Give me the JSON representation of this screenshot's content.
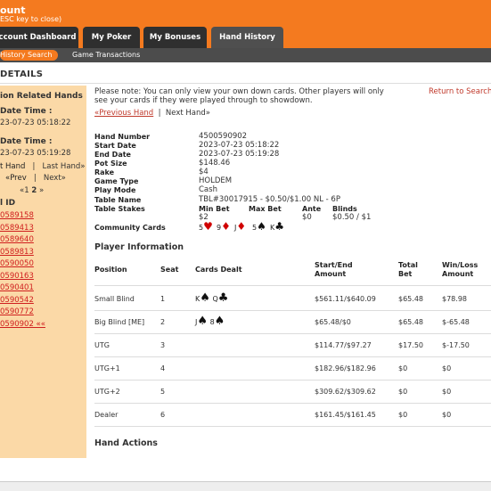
{
  "header": {
    "title": "ount",
    "subtitle": "ESC key to close)",
    "tabs": [
      {
        "label": "ccount Dashboard"
      },
      {
        "label": "My Poker"
      },
      {
        "label": "My Bonuses"
      },
      {
        "label": "Hand History"
      }
    ],
    "subtabs": [
      {
        "label": "History Search"
      },
      {
        "label": "Game Transactions"
      }
    ]
  },
  "page_title": "DETAILS",
  "sidebar": {
    "heading": "ion Related Hands",
    "start_label": "Date Time :",
    "start_value": "23-07-23 05:18:22",
    "end_label": "Date Time :",
    "end_value": "23-07-23 05:19:28",
    "first_hand": "t Hand",
    "sep": "|",
    "last_hand": "Last Hand»",
    "prev": "«Prev",
    "next": "Next»",
    "pager_prefix": "«1",
    "pager_current": "2",
    "pager_suffix": "»",
    "id_heading": "l ID",
    "ids": [
      "0589158",
      "0589413",
      "0589640",
      "0589813",
      "0590050",
      "0590163",
      "0590401",
      "0590542",
      "0590772",
      "0590902 ««"
    ]
  },
  "content": {
    "note": "Please note: You can only view your own down cards. Other players will only see your cards if they were played through to showdown.",
    "return_link": "Return to Search",
    "prev_hand": "«Previous Hand",
    "nav_sep": "|",
    "next_hand": "Next Hand»",
    "details": [
      {
        "label": "Hand Number",
        "value": "4500590902"
      },
      {
        "label": "Start Date",
        "value": "2023-07-23 05:18:22"
      },
      {
        "label": "End Date",
        "value": "2023-07-23 05:19:28"
      },
      {
        "label": "Pot Size",
        "value": "$148.46"
      },
      {
        "label": "Rake",
        "value": "$4"
      },
      {
        "label": "Game Type",
        "value": "HOLDEM"
      },
      {
        "label": "Play Mode",
        "value": "Cash"
      },
      {
        "label": "Table Name",
        "value": "TBL#30017915 - $0.50/$1.00 NL - 6P"
      }
    ],
    "stakes_label": "Table Stakes",
    "stakes": {
      "min_bet_label": "Min Bet",
      "min_bet": "$2",
      "max_bet_label": "Max Bet",
      "max_bet": "",
      "ante_label": "Ante",
      "ante": "$0",
      "blinds_label": "Blinds",
      "blinds": "$0.50 / $1"
    },
    "community_label": "Community Cards",
    "community_cards": [
      {
        "rank": "5",
        "suit": "♥",
        "color": "red"
      },
      {
        "rank": "9",
        "suit": "♦",
        "color": "red"
      },
      {
        "rank": "J",
        "suit": "♦",
        "color": "red"
      },
      {
        "rank": "5",
        "suit": "♠",
        "color": "black"
      },
      {
        "rank": "K",
        "suit": "♣",
        "color": "black"
      }
    ],
    "player_info_title": "Player Information",
    "columns": {
      "position": "Position",
      "seat": "Seat",
      "cards": "Cards Dealt",
      "start_end": "Start/End Amount",
      "total_bet": "Total Bet",
      "win_loss": "Win/Loss Amount"
    },
    "players": [
      {
        "position": "Small Blind",
        "seat": "1",
        "cards": [
          {
            "rank": "K",
            "suit": "♠"
          },
          {
            "rank": "Q",
            "suit": "♣"
          }
        ],
        "start_end": "$561.11/$640.09",
        "total_bet": "$65.48",
        "win_loss": "$78.98"
      },
      {
        "position": "Big Blind [ME]",
        "seat": "2",
        "cards": [
          {
            "rank": "J",
            "suit": "♠"
          },
          {
            "rank": "8",
            "suit": "♠"
          }
        ],
        "start_end": "$65.48/$0",
        "total_bet": "$65.48",
        "win_loss": "$-65.48"
      },
      {
        "position": "UTG",
        "seat": "3",
        "cards": [],
        "start_end": "$114.77/$97.27",
        "total_bet": "$17.50",
        "win_loss": "$-17.50"
      },
      {
        "position": "UTG+1",
        "seat": "4",
        "cards": [],
        "start_end": "$182.96/$182.96",
        "total_bet": "$0",
        "win_loss": "$0"
      },
      {
        "position": "UTG+2",
        "seat": "5",
        "cards": [],
        "start_end": "$309.62/$309.62",
        "total_bet": "$0",
        "win_loss": "$0"
      },
      {
        "position": "Dealer",
        "seat": "6",
        "cards": [],
        "start_end": "$161.45/$161.45",
        "total_bet": "$0",
        "win_loss": "$0"
      }
    ],
    "hand_actions_title": "Hand Actions"
  }
}
